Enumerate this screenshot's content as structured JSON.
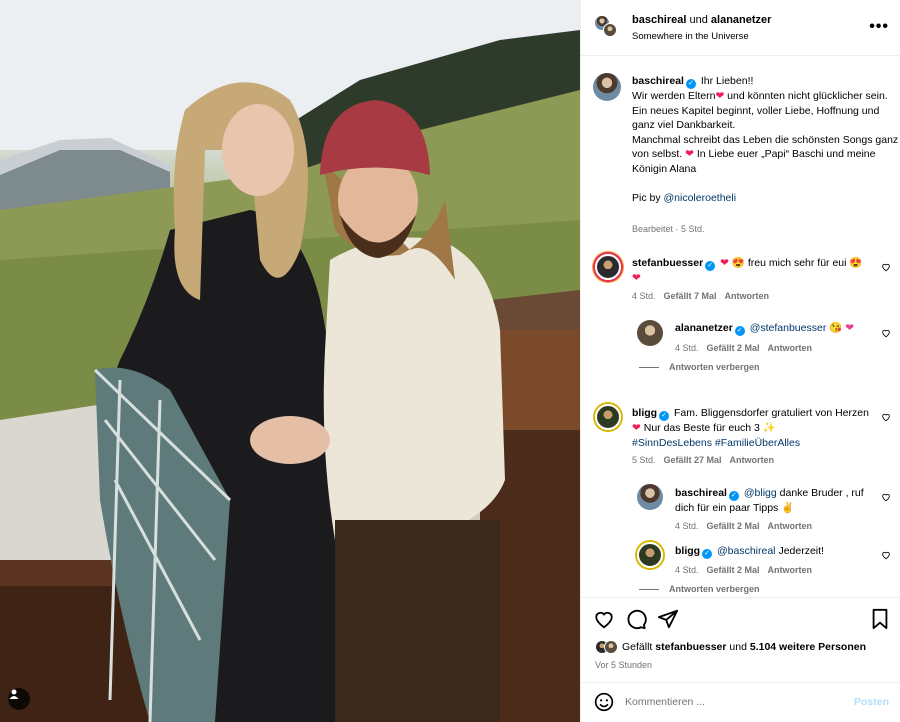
{
  "header": {
    "user1": "baschireal",
    "connector": "und",
    "user2": "alananetzer",
    "location": "Somewhere in the Universe",
    "more_icon": "more-horizontal-icon"
  },
  "caption": {
    "username": "baschireal",
    "line1": "Ihr Lieben!!",
    "line2a": "Wir werden Eltern",
    "line2b": " und könnten nicht glücklicher sein.",
    "line3": "Ein neues Kapitel beginnt, voller Liebe, Hoffnung und ganz viel Dankbarkeit.",
    "line4a": "Manchmal schreibt das Leben die schönsten Songs ganz von selbst. ",
    "line4b": "In Liebe euer „Papi“ Baschi und meine Königin Alana",
    "pic_by": "Pic by ",
    "pic_link": "@nicoleroetheli",
    "meta": "Bearbeitet · 5 Std."
  },
  "comments": [
    {
      "username": "stefanbuesser",
      "text": "freu mich sehr für eui",
      "time": "4 Std.",
      "likes": "Gefällt 7 Mal",
      "reply": "Antworten"
    },
    {
      "username": "alananetzer",
      "mention": "@stefanbuesser",
      "time": "4 Std.",
      "likes": "Gefällt 2 Mal",
      "reply": "Antworten",
      "hide": "Antworten verbergen"
    },
    {
      "username": "bligg",
      "text1": "Fam. Bliggensdorfer gratuliert von Herzen ",
      "text2": " Nur das Beste für euch 3 ",
      "hashtag1": "#SinnDesLebens",
      "hashtag2": "#FamilieÜberAlles",
      "time": "5 Std.",
      "likes": "Gefällt 27 Mal",
      "reply": "Antworten"
    },
    {
      "username": "baschireal",
      "mention": "@bligg",
      "text": " danke Bruder , ruf dich für ein paar Tipps ",
      "time": "4 Std.",
      "likes": "Gefällt 2 Mal",
      "reply": "Antworten"
    },
    {
      "username": "bligg",
      "mention": "@baschireal",
      "text": " Jederzeit!",
      "time": "4 Std.",
      "likes": "Gefällt 2 Mal",
      "reply": "Antworten",
      "hide": "Antworten verbergen"
    }
  ],
  "actions": {
    "icons": [
      "heart-icon",
      "comment-icon",
      "share-icon",
      "bookmark-icon"
    ],
    "likes_prefix": "Gefällt ",
    "likes_user": "stefanbuesser",
    "likes_mid": " und ",
    "likes_count": "5.104 weitere Personen",
    "time": "Vor 5 Stunden"
  },
  "comment_bar": {
    "placeholder": "Kommentieren ...",
    "post": "Posten"
  },
  "colors": {
    "accent": "#0095f6",
    "link": "#00376b",
    "muted": "#737373",
    "heart": "#ed1e5a"
  }
}
